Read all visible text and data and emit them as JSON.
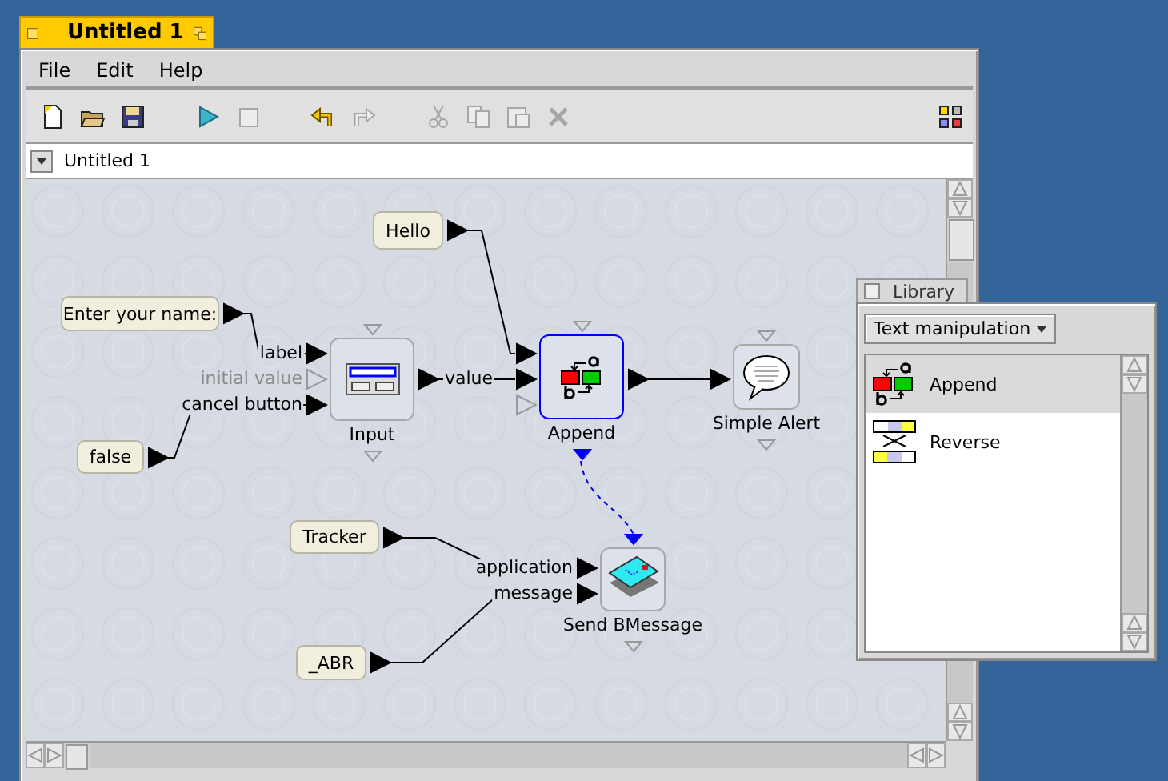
{
  "window": {
    "title": "Untitled 1"
  },
  "menu": [
    {
      "label": "File"
    },
    {
      "label": "Edit"
    },
    {
      "label": "Help"
    }
  ],
  "toolbar": [
    {
      "kind": "new",
      "disabled": false
    },
    {
      "kind": "open",
      "disabled": false
    },
    {
      "kind": "save",
      "disabled": false
    },
    {
      "kind": "run",
      "disabled": false
    },
    {
      "kind": "stop",
      "disabled": true
    },
    {
      "kind": "undo",
      "disabled": false
    },
    {
      "kind": "redo",
      "disabled": true
    },
    {
      "kind": "cut",
      "disabled": true
    },
    {
      "kind": "copy",
      "disabled": true
    },
    {
      "kind": "paste",
      "disabled": true
    },
    {
      "kind": "delete",
      "disabled": true
    },
    {
      "kind": "palette",
      "disabled": false
    }
  ],
  "document": {
    "title": "Untitled 1"
  },
  "canvas": {
    "values": [
      {
        "text": "Hello"
      },
      {
        "text": "Enter your name:"
      },
      {
        "text": "false"
      },
      {
        "text": "Tracker"
      },
      {
        "text": "_ABR"
      }
    ],
    "blocks": [
      {
        "kind": "input",
        "name": "Input",
        "selected": false,
        "trigger_in": false,
        "trigger_out": false,
        "inputs": [
          {
            "label": "label",
            "connected": true
          },
          {
            "label": "initial value",
            "connected": false
          },
          {
            "label": "cancel button",
            "connected": true
          }
        ],
        "outputs": [
          {
            "label": "value",
            "connected": true
          }
        ]
      },
      {
        "kind": "append",
        "name": "Append",
        "selected": true,
        "trigger_in": false,
        "trigger_out": true,
        "inputs": [
          {
            "connected": true
          },
          {
            "connected": true
          },
          {
            "connected": false
          }
        ],
        "outputs": [
          {
            "connected": true
          }
        ]
      },
      {
        "kind": "alert",
        "name": "Simple Alert",
        "selected": false,
        "trigger_in": false,
        "trigger_out": false,
        "inputs": [
          {
            "connected": true
          }
        ]
      },
      {
        "kind": "send",
        "name": "Send BMessage",
        "selected": false,
        "trigger_in": true,
        "trigger_out": false,
        "inputs": [
          {
            "label": "application",
            "connected": true
          },
          {
            "label": "message",
            "connected": true
          }
        ]
      }
    ]
  },
  "library": {
    "title": "Library",
    "category": "Text manipulation",
    "items": [
      {
        "kind": "append",
        "name": "Append",
        "selected": true
      },
      {
        "kind": "reverse",
        "name": "Reverse",
        "selected": false
      }
    ]
  }
}
